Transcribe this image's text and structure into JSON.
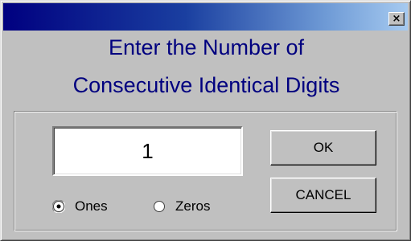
{
  "dialog": {
    "heading_line1": "Enter the Number of",
    "heading_line2": "Consecutive Identical Digits",
    "close_glyph": "×"
  },
  "input": {
    "value": "1"
  },
  "radios": {
    "ones": {
      "label": "Ones",
      "selected": true
    },
    "zeros": {
      "label": "Zeros",
      "selected": false
    }
  },
  "buttons": {
    "ok": "OK",
    "cancel": "CANCEL"
  },
  "colors": {
    "titlebar_start": "#000080",
    "titlebar_end": "#a6caf0",
    "heading": "#00007f",
    "face": "#c0c0c0"
  }
}
